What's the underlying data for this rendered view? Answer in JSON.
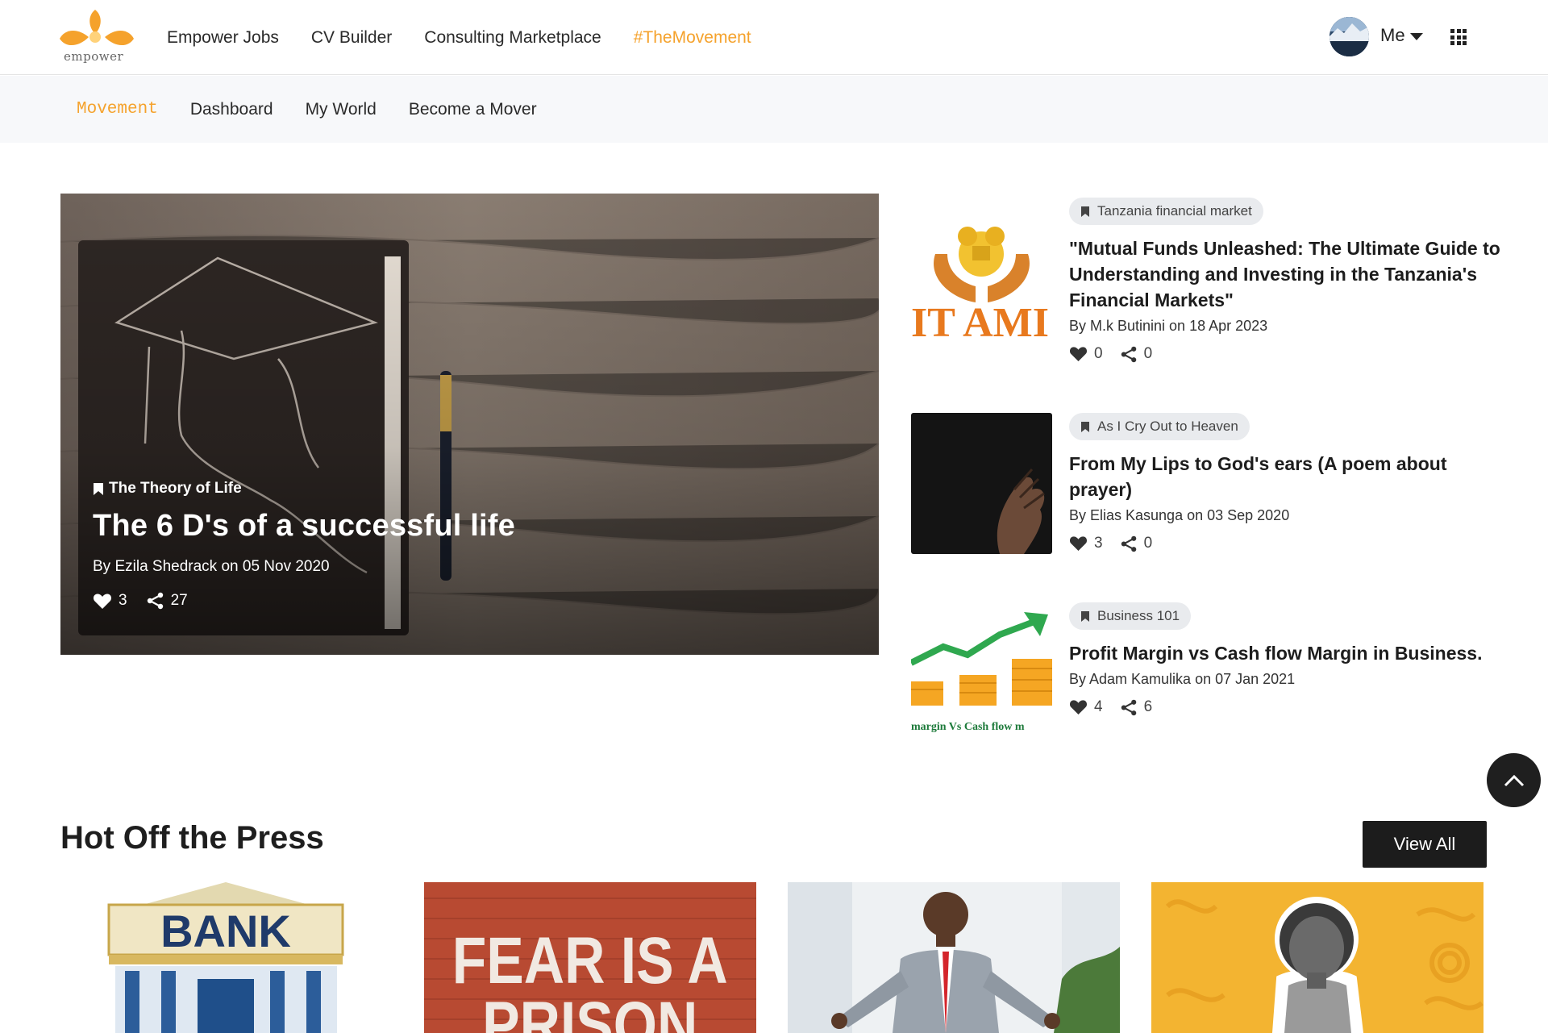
{
  "brand": {
    "name": "empower",
    "accent": "#f5a22c"
  },
  "topnav": {
    "items": [
      {
        "label": "Empower Jobs",
        "active": false
      },
      {
        "label": "CV Builder",
        "active": false
      },
      {
        "label": "Consulting Marketplace",
        "active": false
      },
      {
        "label": "#TheMovement",
        "active": true
      }
    ],
    "user_label": "Me"
  },
  "subnav": {
    "items": [
      {
        "label": "Movement",
        "active": true
      },
      {
        "label": "Dashboard",
        "active": false
      },
      {
        "label": "My World",
        "active": false
      },
      {
        "label": "Become a Mover",
        "active": false
      }
    ]
  },
  "hero": {
    "category": "The Theory of Life",
    "title": "The 6 D's of a successful life",
    "byline": "By Ezila Shedrack on 05 Nov 2020",
    "likes": "3",
    "shares": "27"
  },
  "side_articles": [
    {
      "category": "Tanzania financial market",
      "title": "\"Mutual Funds Unleashed: The Ultimate Guide to Understanding and Investing in the Tanzania's Financial Markets\"",
      "byline": "By M.k Butinini on 18 Apr 2023",
      "likes": "0",
      "shares": "0",
      "image_text": "IT AMI"
    },
    {
      "category": "As I Cry Out to Heaven",
      "title": "From My Lips to God's ears (A poem about prayer)",
      "byline": "By Elias Kasunga on 03 Sep 2020",
      "likes": "3",
      "shares": "0"
    },
    {
      "category": "Business 101",
      "title": "Profit Margin vs Cash flow Margin in Business.",
      "byline": "By Adam Kamulika on 07 Jan 2021",
      "likes": "4",
      "shares": "6",
      "image_text": "margin Vs Cash flow m"
    }
  ],
  "press": {
    "title": "Hot Off the Press",
    "view_all": "View All",
    "cards": [
      {
        "image_text": "BANK"
      },
      {
        "image_text_line1": "FEAR IS A",
        "image_text_line2": "PRISON"
      },
      {
        "image_text": ""
      },
      {
        "image_text": ""
      }
    ]
  }
}
